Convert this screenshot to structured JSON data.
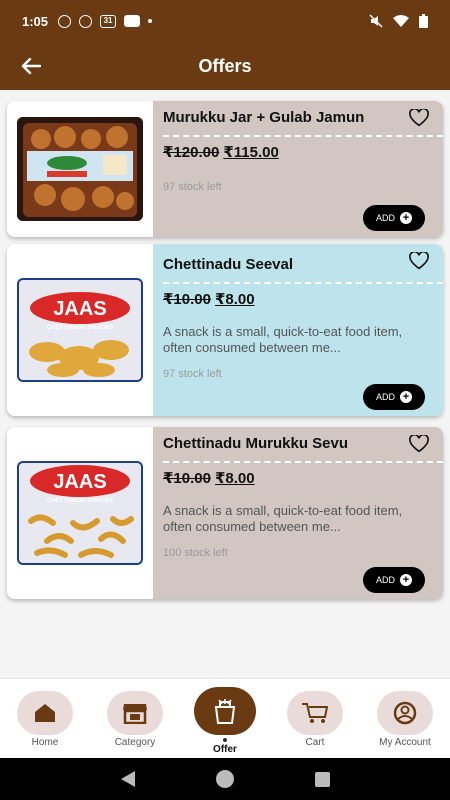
{
  "status_bar": {
    "time": "1:05",
    "calendar_day": "31"
  },
  "app_bar": {
    "title": "Offers"
  },
  "products": [
    {
      "name": "Murukku Jar + Gulab Jamun",
      "price_old": "₹120.00",
      "price_new": "₹115.00",
      "description": "",
      "stock": "97 stock left",
      "add_label": "ADD",
      "bg": "#d2c6c3"
    },
    {
      "name": "Chettinadu Seeval",
      "price_old": "₹10.00",
      "price_new": "₹8.00",
      "description": "A snack is a small, quick-to-eat food item, often consumed between me...",
      "stock": "97 stock left",
      "add_label": "ADD",
      "bg": "#bde4ec"
    },
    {
      "name": "Chettinadu Murukku Sevu",
      "price_old": "₹10.00",
      "price_new": "₹8.00",
      "description": "A snack is a small, quick-to-eat food item, often consumed between me...",
      "stock": "100 stock left",
      "add_label": "ADD",
      "bg": "#d2c6c3"
    }
  ],
  "image_text": {
    "brand": "JAAS",
    "tagline": "CHETTINADU SNACKS"
  },
  "bottom_nav": [
    {
      "label": "Home",
      "icon": "home-icon"
    },
    {
      "label": "Category",
      "icon": "store-icon"
    },
    {
      "label": "Offer",
      "icon": "offer-bag-icon",
      "active": true
    },
    {
      "label": "Cart",
      "icon": "cart-icon"
    },
    {
      "label": "My Account",
      "icon": "account-icon"
    }
  ],
  "colors": {
    "brand": "#6a3b12",
    "card_neutral": "#d2c6c3",
    "card_highlight": "#bde4ec",
    "nav_bubble": "#eadbdb"
  }
}
